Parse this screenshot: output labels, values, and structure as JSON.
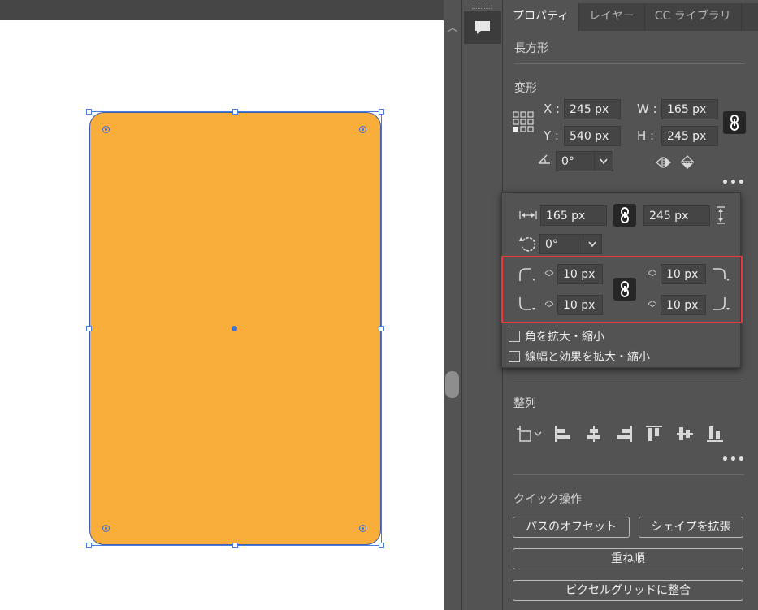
{
  "tabs": [
    {
      "label": "プロパティ"
    },
    {
      "label": "レイヤー"
    },
    {
      "label": "CC ライブラリ"
    }
  ],
  "object_type": "長方形",
  "transform": {
    "title": "変形",
    "x_label": "X :",
    "x_value": "245 px",
    "y_label": "Y :",
    "y_value": "540 px",
    "w_label": "W :",
    "w_value": "165 px",
    "h_label": "H :",
    "h_value": "245 px",
    "angle_value": "0°"
  },
  "rect_popup": {
    "width_value": "165 px",
    "height_value": "245 px",
    "rotation_value": "0°",
    "corner_top_left": "10 px",
    "corner_top_right": "10 px",
    "corner_bottom_left": "10 px",
    "corner_bottom_right": "10 px",
    "scale_corners_label": "角を拡大・縮小",
    "scale_strokes_label": "線幅と効果を拡大・縮小"
  },
  "align": {
    "title": "整列"
  },
  "quick_actions": {
    "title": "クイック操作",
    "offset_path": "パスのオフセット",
    "expand_shape": "シェイプを拡張",
    "arrange": "重ね順",
    "align_pixel_grid": "ピクセルグリッドに整合"
  },
  "colors": {
    "shape_fill": "#f9ad3a",
    "selection": "#4a7be0",
    "highlight": "#e8393d"
  },
  "icons": {
    "comments": "comments-icon",
    "reference_point": "reference-point-icon",
    "link": "link-icon",
    "flip_horizontal": "flip-horizontal-icon",
    "flip_vertical": "flip-vertical-icon"
  }
}
